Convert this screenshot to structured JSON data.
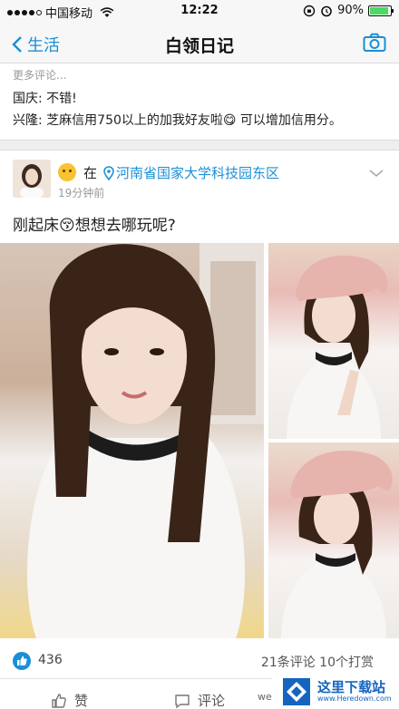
{
  "status_bar": {
    "carrier": "中国移动",
    "time": "12:22",
    "battery": "90%",
    "battery_level": 0.9
  },
  "nav": {
    "back_label": "生活",
    "title": "白领日记"
  },
  "previous_post": {
    "more_comments": "更多评论...",
    "comments": [
      {
        "name": "国庆:",
        "text": " 不错!"
      },
      {
        "name": "兴隆:",
        "text": " 芝麻信用750以上的加我好友啦😋 可以增加信用分。"
      }
    ]
  },
  "post": {
    "at_label": "在",
    "location": "河南省国家大学科技园东区",
    "time": "19分钟前",
    "text": "刚起床😚想想去哪玩呢?",
    "likes": "436",
    "stats": "21条评论  10个打赏"
  },
  "actions": {
    "like_label": "赞",
    "comment_label": "评论"
  },
  "watermark": {
    "name": "这里下载站",
    "url": "www.Heredown.com",
    "small": "weiwe"
  },
  "colors": {
    "accent": "#1a8fd6",
    "battery": "#4cd964"
  }
}
